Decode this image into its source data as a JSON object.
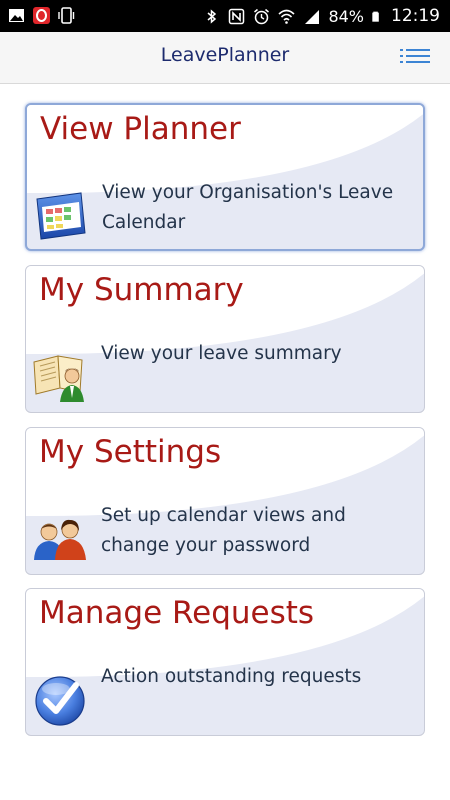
{
  "status_bar": {
    "battery_percent": "84%",
    "time": "12:19",
    "left_icons": [
      "gallery-icon",
      "opera-mini-icon",
      "phone-vibrate-icon"
    ],
    "right_icons": [
      "bluetooth-icon",
      "nfc-icon",
      "alarm-icon",
      "wifi-icon",
      "signal-icon",
      "battery-icon"
    ]
  },
  "app_bar": {
    "title": "LeavePlanner",
    "menu_icon": "list-menu-icon"
  },
  "colors": {
    "title_red": "#a81a16",
    "app_title_blue": "#1d2b6e",
    "card_background": "#e6e9f4",
    "menu_icon_blue": "#3c84d4"
  },
  "cards": [
    {
      "title": "View Planner",
      "description": "View your Organisation's Leave Calendar",
      "icon": "calendar-icon",
      "selected": true
    },
    {
      "title": "My Summary",
      "description": "View your leave summary",
      "icon": "summary-book-person-icon",
      "selected": false
    },
    {
      "title": "My Settings",
      "description": "Set up calendar views and change your password",
      "icon": "users-icon",
      "selected": false
    },
    {
      "title": "Manage Requests",
      "description": "Action outstanding requests",
      "icon": "checkmark-icon",
      "selected": false
    }
  ]
}
